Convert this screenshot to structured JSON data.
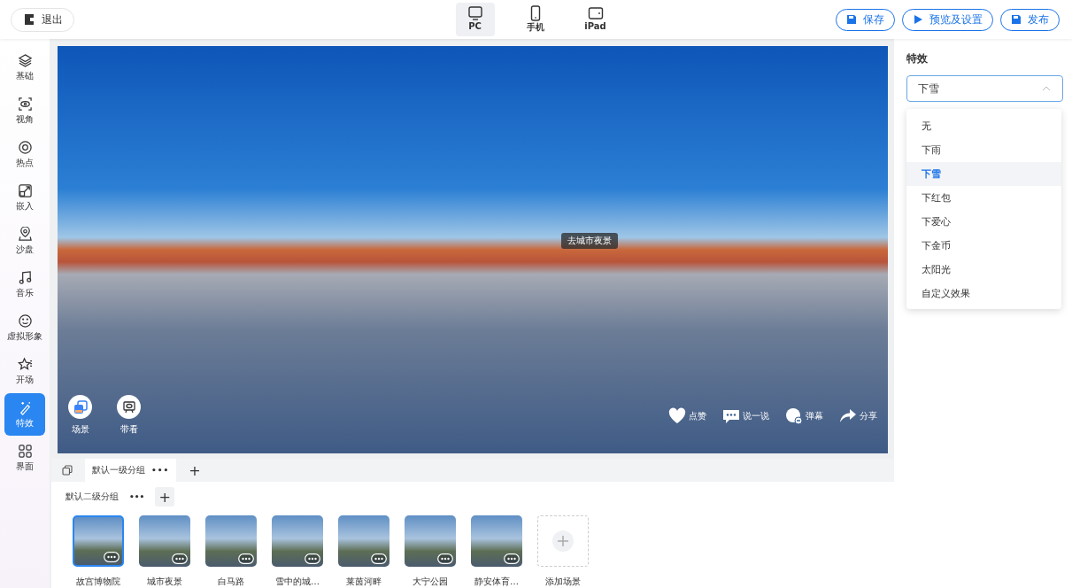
{
  "exit_button": "退出",
  "devices": [
    {
      "label": "PC",
      "kind": "pc",
      "selected": true
    },
    {
      "label": "手机",
      "kind": "phone",
      "selected": false
    },
    {
      "label": "iPad",
      "kind": "tablet",
      "selected": false
    }
  ],
  "actions": [
    {
      "label": "保存",
      "kind": "save"
    },
    {
      "label": "预览及设置",
      "kind": "play"
    },
    {
      "label": "发布",
      "kind": "save"
    }
  ],
  "sidebar": {
    "items": [
      {
        "label": "基础",
        "kind": "layers",
        "selected": false
      },
      {
        "label": "视角",
        "kind": "view",
        "selected": false
      },
      {
        "label": "热点",
        "kind": "target",
        "selected": false
      },
      {
        "label": "嵌入",
        "kind": "embed",
        "selected": false
      },
      {
        "label": "沙盘",
        "kind": "pin",
        "selected": false
      },
      {
        "label": "音乐",
        "kind": "music",
        "selected": false
      },
      {
        "label": "虚拟形象",
        "kind": "face",
        "selected": false
      },
      {
        "label": "开场",
        "kind": "star",
        "selected": false
      },
      {
        "label": "特效",
        "kind": "wand",
        "selected": true
      },
      {
        "label": "界面",
        "kind": "grid",
        "selected": false
      }
    ]
  },
  "viewer": {
    "hotspot": "去城市夜景",
    "left_buttons": [
      {
        "label": "场景",
        "kind": "scenes"
      },
      {
        "label": "带看",
        "kind": "guide"
      }
    ],
    "right_buttons": [
      {
        "label": "点赞",
        "kind": "like"
      },
      {
        "label": "说一说",
        "kind": "comment"
      },
      {
        "label": "弹幕",
        "kind": "danmaku"
      },
      {
        "label": "分享",
        "kind": "share"
      }
    ]
  },
  "scene_panel": {
    "group_tabs": [
      {
        "label": "默认一级分组",
        "more": "•••",
        "selected": true
      }
    ],
    "add_group": "+",
    "subgroup": {
      "label": "默认二级分组",
      "more": "•••",
      "add": "+"
    },
    "scenes": [
      {
        "label": "故宫博物院",
        "selected": true
      },
      {
        "label": "城市夜景",
        "selected": false
      },
      {
        "label": "白马路",
        "selected": false
      },
      {
        "label": "雪中的城…",
        "selected": false
      },
      {
        "label": "莱茵河畔",
        "selected": false
      },
      {
        "label": "大宁公园",
        "selected": false
      },
      {
        "label": "静安体育…",
        "selected": false
      }
    ],
    "add_scene": "添加场景"
  },
  "effects_panel": {
    "title": "特效",
    "value": "下雪",
    "expanded": true,
    "options": [
      {
        "label": "无",
        "selected": false
      },
      {
        "label": "下雨",
        "selected": false
      },
      {
        "label": "下雪",
        "selected": true
      },
      {
        "label": "下红包",
        "selected": false
      },
      {
        "label": "下爱心",
        "selected": false
      },
      {
        "label": "下金币",
        "selected": false
      },
      {
        "label": "太阳光",
        "selected": false
      },
      {
        "label": "自定义效果",
        "selected": false
      }
    ]
  }
}
